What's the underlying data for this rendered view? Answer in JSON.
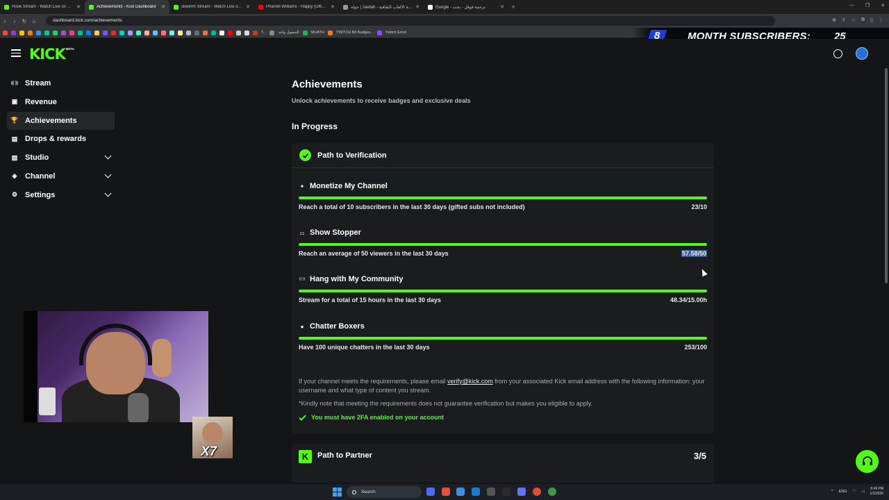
{
  "browser": {
    "tabs": [
      {
        "title": "Hook Stream - Watch Live on Kick",
        "color": "#53fc18",
        "active": false
      },
      {
        "title": "Achievements - Kick Dashboard",
        "color": "#53fc18",
        "active": true
      },
      {
        "title": "skwerm Stream - Watch Live on K",
        "color": "#53fc18",
        "active": false
      },
      {
        "title": "Pharrell Williams - Happy (Official",
        "color": "#ff0000",
        "active": false
      },
      {
        "title": "جولة | Jawlah - منصة الألعاب الثقافية",
        "color": "#999999",
        "active": false
      },
      {
        "title": "Google - ترجمة قوقل - بحث",
        "color": "#ffffff",
        "active": false
      }
    ],
    "url": "dashboard.kick.com/achievements",
    "bookmarks": [
      "T...",
      "الحصول واحد",
      "MUATH",
      "TWITCH Bit Badges...",
      "Twitch Emot"
    ]
  },
  "overlay": {
    "left_number": "8",
    "title": "MONTH SUBSCRIBERS:",
    "right_number": "25"
  },
  "app": {
    "logo": "KICK",
    "logo_badge": "BETA"
  },
  "sidebar": {
    "items": [
      {
        "label": "Stream",
        "icon": "broadcast-icon",
        "glyph": "((·))",
        "active": false,
        "expandable": false
      },
      {
        "label": "Revenue",
        "icon": "chart-icon",
        "glyph": "▣",
        "active": false,
        "expandable": false
      },
      {
        "label": "Achievements",
        "icon": "trophy-icon",
        "glyph": "🏆",
        "active": true,
        "expandable": false
      },
      {
        "label": "Drops & rewards",
        "icon": "gift-icon",
        "glyph": "▤",
        "active": false,
        "expandable": false
      },
      {
        "label": "Studio",
        "icon": "studio-icon",
        "glyph": "▧",
        "active": false,
        "expandable": true
      },
      {
        "label": "Channel",
        "icon": "channel-icon",
        "glyph": "◈",
        "active": false,
        "expandable": true
      },
      {
        "label": "Settings",
        "icon": "gear-icon",
        "glyph": "⚙",
        "active": false,
        "expandable": true
      }
    ]
  },
  "main": {
    "title": "Achievements",
    "subtitle": "Unlock achievements to receive badges and exclusive deals",
    "section": "In Progress",
    "card": {
      "title": "Path to Verification",
      "achievements": [
        {
          "name": "Monetize My Channel",
          "icon": "sparkle-icon",
          "glyph": "✦",
          "description": "Reach a total of 10 subscribers in the last 30 days (gifted subs not included)",
          "value": "23/10",
          "progress": 1.0,
          "selected": false
        },
        {
          "name": "Show Stopper",
          "icon": "viewers-icon",
          "glyph": "⚏",
          "description": "Reach an average of 50 viewers in the last 30 days",
          "value": "57.58/50",
          "progress": 1.0,
          "selected": true
        },
        {
          "name": "Hang with My Community",
          "icon": "antenna-icon",
          "glyph": "((·))",
          "description": "Stream for a total of 15 hours in the last 30 days",
          "value": "48.34/15.00h",
          "progress": 1.0,
          "selected": false
        },
        {
          "name": "Chatter Boxers",
          "icon": "chat-bubble-icon",
          "glyph": "●",
          "description": "Have 100 unique chatters in the last 30 days",
          "value": "253/100",
          "progress": 1.0,
          "selected": false
        }
      ],
      "info_pre": "If your channel meets the requirements, please email ",
      "info_link": "verify@kick.com",
      "info_post": " from your associated Kick email address with the following information: your username and what type of content you stream.",
      "note": "*Kindly note that meeting the requirements does not guarantee verification but makes you eligible to apply.",
      "requirement": "You must have 2FA enabled on your account"
    },
    "partner": {
      "title": "Path to Partner",
      "value": "3/5",
      "logo": "K"
    }
  },
  "webcam": {
    "badge": "X7"
  },
  "taskbar": {
    "search_placeholder": "Search",
    "language": "ENG",
    "time": "8:49 PM",
    "date": "1/2/2026"
  },
  "colors": {
    "accent": "#53fc18",
    "background": "#141517",
    "card": "#1b1c1f"
  }
}
